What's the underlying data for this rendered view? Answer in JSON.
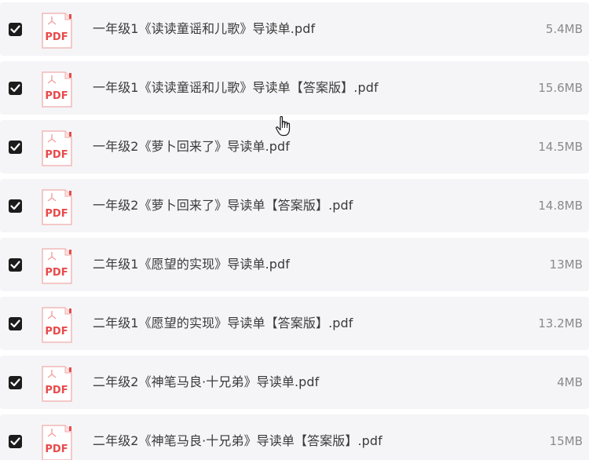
{
  "files": [
    {
      "name": "一年级1《读读童谣和儿歌》导读单.pdf",
      "size": "5.4MB",
      "icon_label": "PDF",
      "checked": true
    },
    {
      "name": "一年级1《读读童谣和儿歌》导读单【答案版】.pdf",
      "size": "15.6MB",
      "icon_label": "PDF",
      "checked": true
    },
    {
      "name": "一年级2《萝卜回来了》导读单.pdf",
      "size": "14.5MB",
      "icon_label": "PDF",
      "checked": true
    },
    {
      "name": "一年级2《萝卜回来了》导读单【答案版】.pdf",
      "size": "14.8MB",
      "icon_label": "PDF",
      "checked": true
    },
    {
      "name": "二年级1《愿望的实现》导读单.pdf",
      "size": "13MB",
      "icon_label": "PDF",
      "checked": true
    },
    {
      "name": "二年级1《愿望的实现》导读单【答案版】.pdf",
      "size": "13.2MB",
      "icon_label": "PDF",
      "checked": true
    },
    {
      "name": "二年级2《神笔马良·十兄弟》导读单.pdf",
      "size": "4MB",
      "icon_label": "PDF",
      "checked": true
    },
    {
      "name": "二年级2《神笔马良·十兄弟》导读单【答案版】.pdf",
      "size": "15MB",
      "icon_label": "PDF",
      "checked": true
    }
  ],
  "colors": {
    "row_bg": "#f5f5f7",
    "pdf_red": "#e84a4a",
    "checkbox": "#1c1c1c"
  }
}
